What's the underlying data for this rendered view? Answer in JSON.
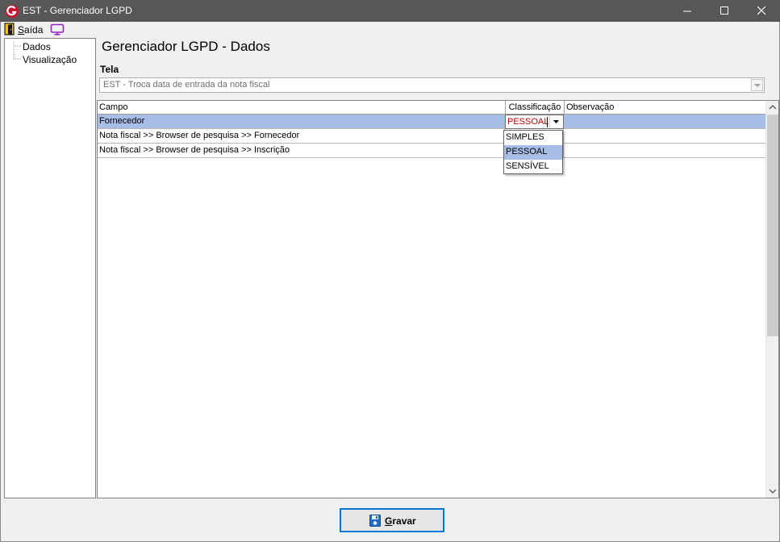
{
  "window": {
    "title": "EST - Gerenciador LGPD",
    "minimize_icon": "minimize-icon",
    "maximize_icon": "maximize-icon",
    "close_icon": "close-icon"
  },
  "menu": {
    "saida_accel": "S",
    "saida_rest": "aída",
    "exit_icon": "exit-door-icon",
    "monitor_icon": "monitor-icon"
  },
  "tree": {
    "items": [
      {
        "label": "Dados"
      },
      {
        "label": "Visualização"
      }
    ]
  },
  "page": {
    "title": "Gerenciador LGPD - Dados",
    "tela_label": "Tela",
    "tela_value": "EST - Troca data de entrada da nota fiscal"
  },
  "grid": {
    "headers": [
      "Campo",
      "Classificação",
      "Observação"
    ],
    "rows": [
      {
        "campo": "Fornecedor",
        "classificacao": "PESSOAL",
        "observacao": ""
      },
      {
        "campo": "Nota fiscal >> Browser de pesquisa >> Fornecedor",
        "classificacao": "",
        "observacao": ""
      },
      {
        "campo": "Nota fiscal >> Browser de pesquisa >> Inscrição",
        "classificacao": "",
        "observacao": ""
      }
    ],
    "selected_row": 0,
    "editor_value": "PESSOAL",
    "dropdown_options": [
      "SIMPLES",
      "PESSOAL",
      "SENSÍVEL"
    ],
    "dropdown_highlighted": 1
  },
  "actions": {
    "save_accel": "G",
    "save_rest": "ravar",
    "save_icon": "floppy-disk-icon"
  },
  "colors": {
    "titlebar": "#575757",
    "selection": "#a8bde6",
    "editor_text": "#c00000",
    "focus_border": "#0078d7"
  }
}
